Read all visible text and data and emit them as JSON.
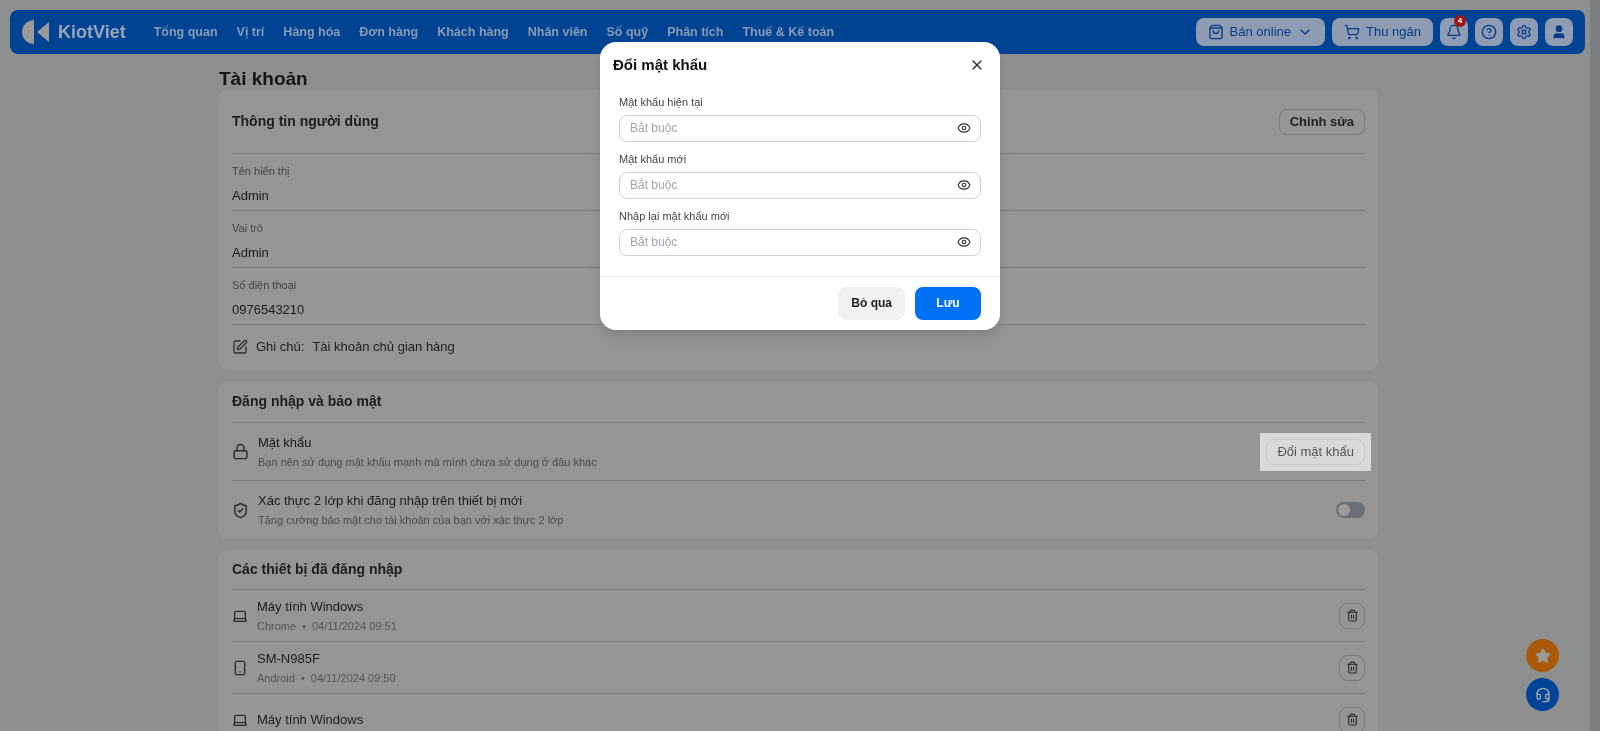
{
  "header": {
    "logo": "KiotViet",
    "nav": [
      "Tổng quan",
      "Vị trí",
      "Hàng hóa",
      "Đơn hàng",
      "Khách hàng",
      "Nhân viên",
      "Sổ quỹ",
      "Phân tích",
      "Thuế & Kế toán"
    ],
    "sell_online": "Bán online",
    "cashier": "Thu ngân",
    "notification_count": "4"
  },
  "page_title": "Tài khoản",
  "user_info": {
    "title": "Thông tin người dùng",
    "edit_button": "Chỉnh sửa",
    "fields": [
      {
        "label": "Tên hiển thị",
        "value": "Admin"
      },
      {
        "label": "Vai trò",
        "value": "Admin"
      },
      {
        "label": "Số điện thoại",
        "value": "0976543210"
      }
    ],
    "note": {
      "label": "Ghi chú:",
      "value": "Tài khoản chủ gian hàng"
    }
  },
  "security": {
    "title": "Đăng nhập và bảo mật",
    "items": [
      {
        "kind": "button",
        "title": "Mật khẩu",
        "description": "Bạn nên sử dụng mật khẩu mạnh mà mình chưa sử dụng ở đâu khác",
        "button": "Đổi mật khẩu"
      },
      {
        "kind": "toggle",
        "title": "Xác thực 2 lớp khi đăng nhập trên thiết bị mới",
        "description": "Tăng cường bảo mật cho tài khoản của bạn với xác thực 2 lớp",
        "on": false
      }
    ]
  },
  "devices": {
    "title": "Các thiết bị đã đăng nhập",
    "items": [
      {
        "kind": "laptop",
        "name": "Máy tính Windows",
        "browser": "Chrome",
        "separator": "•",
        "time": "04/11/2024 09:51"
      },
      {
        "kind": "phone",
        "name": "SM-N985F",
        "browser": "Android",
        "separator": "•",
        "time": "04/11/2024 09:50"
      },
      {
        "kind": "laptop",
        "name": "Máy tính Windows"
      }
    ]
  },
  "dialog": {
    "title": "Đổi mật khẩu",
    "fields": [
      {
        "label": "Mật khẩu hiện tại",
        "placeholder": "Bắt buộc"
      },
      {
        "label": "Mật khẩu mới",
        "placeholder": "Bắt buộc"
      },
      {
        "label": "Nhập lại mật khẩu mới",
        "placeholder": "Bắt buộc"
      }
    ],
    "cancel": "Bỏ qua",
    "save": "Lưu"
  }
}
